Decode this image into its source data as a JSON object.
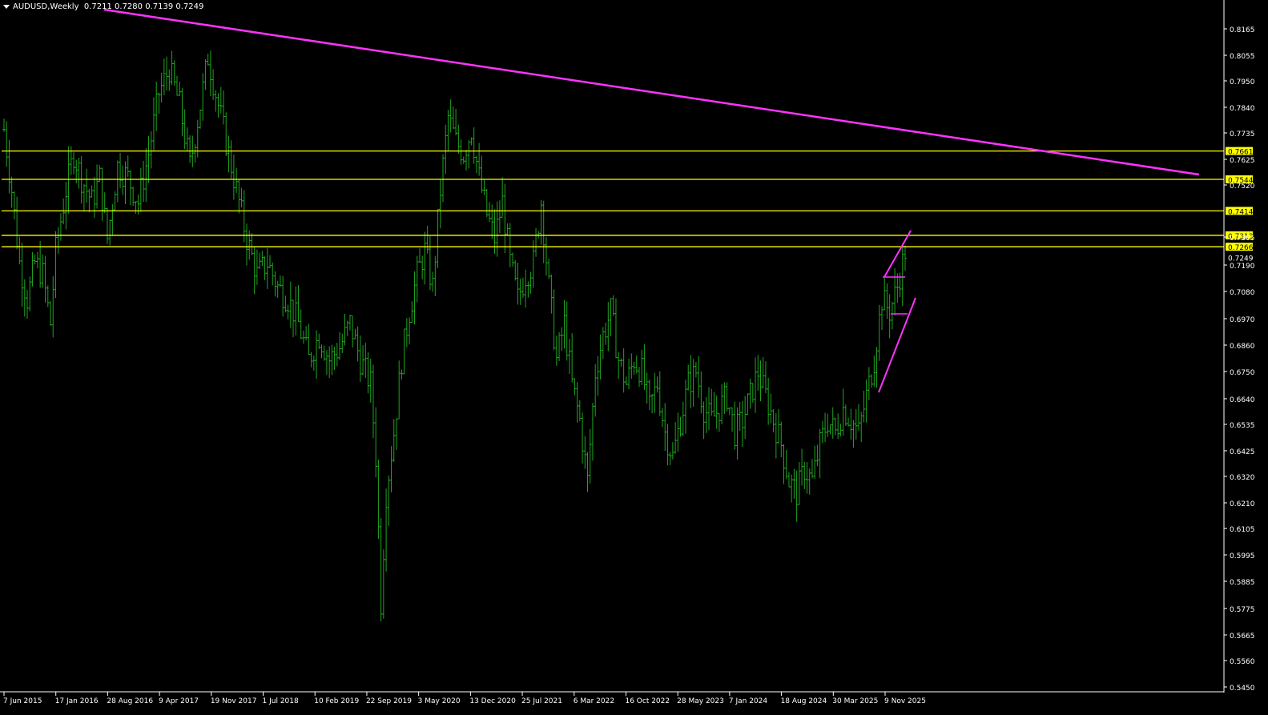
{
  "header": {
    "symbol_tf": "AUDUSD,Weekly",
    "ohlc": "0.7211 0.7280 0.7139 0.7249"
  },
  "chart_data": {
    "type": "candlestick-bars",
    "symbol": "AUDUSD",
    "timeframe": "Weekly",
    "ylim": [
      0.545,
      0.824
    ],
    "y_ticks": [
      "0.8165",
      "0.8055",
      "0.7950",
      "0.7840",
      "0.7735",
      "0.7625",
      "0.7520",
      "0.7305",
      "0.7190",
      "0.7080",
      "0.6970",
      "0.6860",
      "0.6750",
      "0.6640",
      "0.6535",
      "0.6425",
      "0.6320",
      "0.6210",
      "0.6105",
      "0.5995",
      "0.5885",
      "0.5775",
      "0.5665",
      "0.5560",
      "0.5450"
    ],
    "x_ticks": [
      "7 Jun 2015",
      "17 Jan 2016",
      "28 Aug 2016",
      "9 Apr 2017",
      "19 Nov 2017",
      "1 Jul 2018",
      "10 Feb 2019",
      "22 Sep 2019",
      "3 May 2020",
      "13 Dec 2020",
      "25 Jul 2021",
      "6 Mar 2022",
      "16 Oct 2022",
      "28 May 2023",
      "7 Jan 2024",
      "18 Aug 2024",
      "30 Mar 2025",
      "9 Nov 2025"
    ],
    "price_path": [
      [
        0,
        0.775
      ],
      [
        3,
        0.75
      ],
      [
        6,
        0.72
      ],
      [
        9,
        0.705
      ],
      [
        12,
        0.72
      ],
      [
        15,
        0.715
      ],
      [
        18,
        0.695
      ],
      [
        20,
        0.725
      ],
      [
        24,
        0.75
      ],
      [
        27,
        0.765
      ],
      [
        30,
        0.755
      ],
      [
        34,
        0.745
      ],
      [
        37,
        0.755
      ],
      [
        40,
        0.73
      ],
      [
        44,
        0.76
      ],
      [
        48,
        0.755
      ],
      [
        52,
        0.745
      ],
      [
        56,
        0.765
      ],
      [
        60,
        0.79
      ],
      [
        64,
        0.8
      ],
      [
        68,
        0.785
      ],
      [
        72,
        0.76
      ],
      [
        76,
        0.785
      ],
      [
        79,
        0.805
      ],
      [
        82,
        0.79
      ],
      [
        86,
        0.77
      ],
      [
        90,
        0.75
      ],
      [
        94,
        0.73
      ],
      [
        98,
        0.715
      ],
      [
        102,
        0.72
      ],
      [
        106,
        0.71
      ],
      [
        110,
        0.705
      ],
      [
        114,
        0.695
      ],
      [
        118,
        0.68
      ],
      [
        122,
        0.69
      ],
      [
        126,
        0.68
      ],
      [
        130,
        0.685
      ],
      [
        134,
        0.695
      ],
      [
        138,
        0.68
      ],
      [
        142,
        0.67
      ],
      [
        144,
        0.64
      ],
      [
        146,
        0.58
      ],
      [
        148,
        0.625
      ],
      [
        151,
        0.65
      ],
      [
        154,
        0.68
      ],
      [
        157,
        0.7
      ],
      [
        160,
        0.715
      ],
      [
        163,
        0.725
      ],
      [
        166,
        0.71
      ],
      [
        169,
        0.75
      ],
      [
        172,
        0.78
      ],
      [
        175,
        0.77
      ],
      [
        178,
        0.765
      ],
      [
        181,
        0.775
      ],
      [
        184,
        0.755
      ],
      [
        187,
        0.74
      ],
      [
        190,
        0.73
      ],
      [
        193,
        0.745
      ],
      [
        196,
        0.72
      ],
      [
        199,
        0.705
      ],
      [
        202,
        0.715
      ],
      [
        205,
        0.72
      ],
      [
        208,
        0.745
      ],
      [
        211,
        0.71
      ],
      [
        214,
        0.68
      ],
      [
        217,
        0.695
      ],
      [
        220,
        0.67
      ],
      [
        223,
        0.655
      ],
      [
        226,
        0.63
      ],
      [
        229,
        0.675
      ],
      [
        232,
        0.69
      ],
      [
        235,
        0.7
      ],
      [
        238,
        0.68
      ],
      [
        241,
        0.67
      ],
      [
        244,
        0.68
      ],
      [
        247,
        0.675
      ],
      [
        250,
        0.66
      ],
      [
        253,
        0.67
      ],
      [
        256,
        0.65
      ],
      [
        259,
        0.64
      ],
      [
        262,
        0.655
      ],
      [
        265,
        0.67
      ],
      [
        268,
        0.675
      ],
      [
        271,
        0.66
      ],
      [
        274,
        0.655
      ],
      [
        277,
        0.66
      ],
      [
        280,
        0.665
      ],
      [
        283,
        0.65
      ],
      [
        286,
        0.655
      ],
      [
        289,
        0.665
      ],
      [
        292,
        0.675
      ],
      [
        295,
        0.665
      ],
      [
        298,
        0.655
      ],
      [
        301,
        0.645
      ],
      [
        304,
        0.63
      ],
      [
        307,
        0.625
      ],
      [
        310,
        0.635
      ],
      [
        313,
        0.63
      ],
      [
        316,
        0.645
      ],
      [
        319,
        0.655
      ],
      [
        322,
        0.65
      ],
      [
        325,
        0.66
      ],
      [
        328,
        0.655
      ],
      [
        331,
        0.65
      ],
      [
        334,
        0.665
      ],
      [
        337,
        0.68
      ],
      [
        340,
        0.705
      ],
      [
        343,
        0.7
      ],
      [
        346,
        0.71
      ],
      [
        349,
        0.7249
      ]
    ],
    "horizontal_levels": [
      0.7661,
      0.7544,
      0.7414,
      0.7313,
      0.7266
    ],
    "level_labels": [
      "0.7661",
      "0.7544",
      "0.7414",
      "0.7313",
      "0.7266"
    ],
    "current_price": 0.7249,
    "current_label": "0.7249",
    "trendline": {
      "x": [
        "7 Jun 2015",
        "9 Nov 2025"
      ],
      "note": "descending resistance line"
    },
    "colors": {
      "bars": "#1fa51f",
      "levels": "#ffff00",
      "trend": "#ff33ff",
      "bg": "#000000",
      "axis": "#ffffff"
    }
  }
}
